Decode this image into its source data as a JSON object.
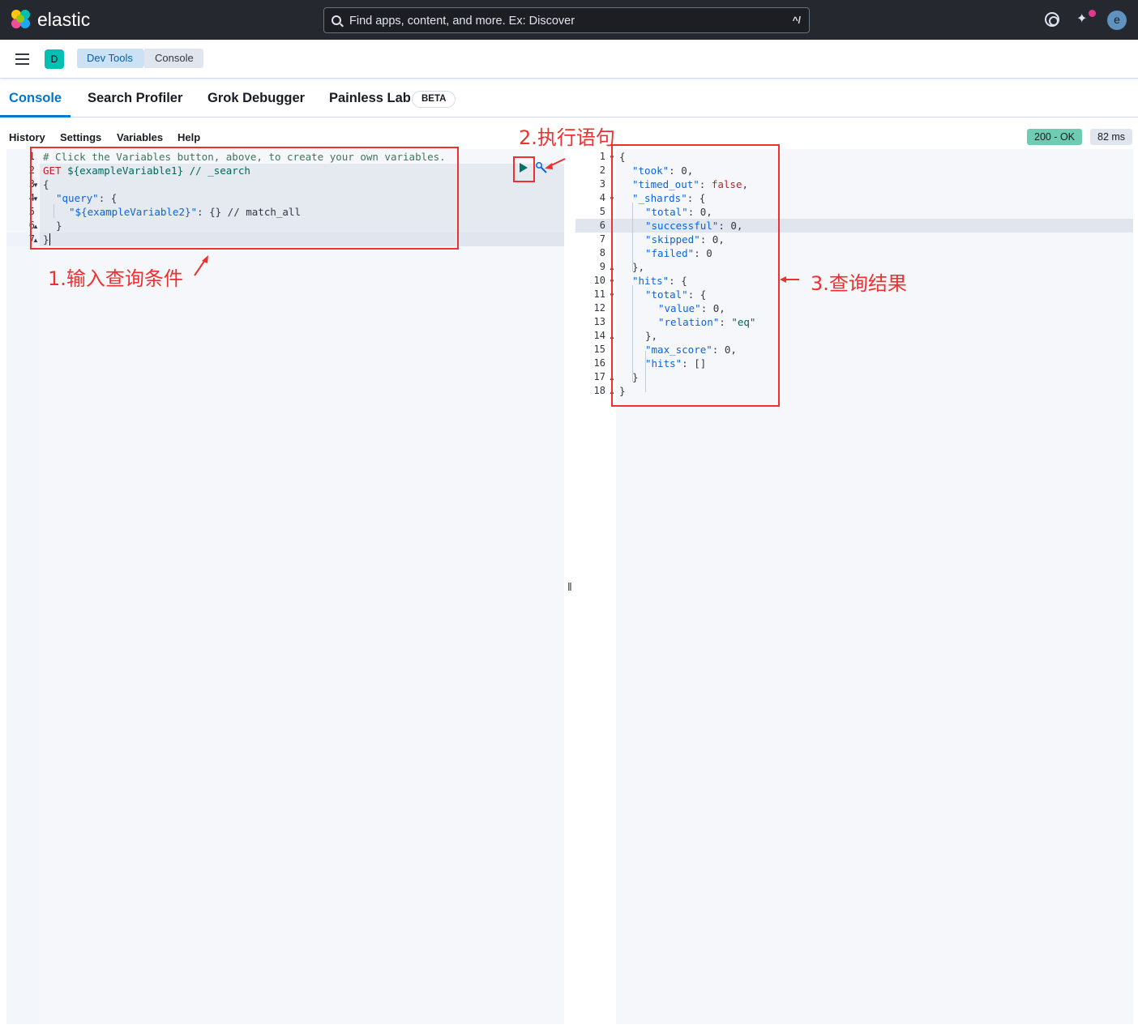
{
  "topbar": {
    "brand": "elastic",
    "search_placeholder": "Find apps, content, and more. Ex: Discover",
    "search_shortcut": "^/",
    "avatar_initial": "e"
  },
  "subbar": {
    "space_initial": "D",
    "breadcrumbs": [
      "Dev Tools",
      "Console"
    ]
  },
  "tabs": [
    {
      "label": "Console",
      "active": true
    },
    {
      "label": "Search Profiler"
    },
    {
      "label": "Grok Debugger"
    },
    {
      "label": "Painless Lab"
    }
  ],
  "beta_badge": "BETA",
  "toolbar": {
    "items": [
      "History",
      "Settings",
      "Variables",
      "Help"
    ],
    "status": "200 - OK",
    "duration": "82 ms"
  },
  "request": {
    "line_numbers": [
      "1",
      "2",
      "3",
      "4",
      "5",
      "6",
      "7"
    ],
    "line1": "# Click the Variables button, above, to create your own variables.",
    "method": "GET",
    "url": "${exampleVariable1} // _search",
    "line3": "{",
    "line4_key": "\"query\"",
    "line4_rest": ": {",
    "line5_key": "\"${exampleVariable2}\"",
    "line5_rest": ": {} // match_all",
    "line6": "}",
    "line7": "}"
  },
  "response": {
    "line_numbers": [
      "1",
      "2",
      "3",
      "4",
      "5",
      "6",
      "7",
      "8",
      "9",
      "10",
      "11",
      "12",
      "13",
      "14",
      "15",
      "16",
      "17",
      "18"
    ],
    "lines": [
      {
        "pre": "{"
      },
      {
        "key": "\"took\"",
        "sep": ": ",
        "val": "0",
        "post": ","
      },
      {
        "key": "\"timed_out\"",
        "sep": ": ",
        "bool": "false",
        "post": ","
      },
      {
        "key": "\"_shards\"",
        "sep": ": {"
      },
      {
        "key": "\"total\"",
        "sep": ": ",
        "val": "0",
        "post": ","
      },
      {
        "key": "\"successful\"",
        "sep": ": ",
        "val": "0",
        "post": ","
      },
      {
        "key": "\"skipped\"",
        "sep": ": ",
        "val": "0",
        "post": ","
      },
      {
        "key": "\"failed\"",
        "sep": ": ",
        "val": "0"
      },
      {
        "pre": "},"
      },
      {
        "key": "\"hits\"",
        "sep": ": {"
      },
      {
        "key": "\"total\"",
        "sep": ": {"
      },
      {
        "key": "\"value\"",
        "sep": ": ",
        "val": "0",
        "post": ","
      },
      {
        "key": "\"relation\"",
        "sep": ": ",
        "str": "\"eq\""
      },
      {
        "pre": "},"
      },
      {
        "key": "\"max_score\"",
        "sep": ": ",
        "val": "0",
        "post": ","
      },
      {
        "key": "\"hits\"",
        "sep": ": []"
      },
      {
        "pre": "}"
      },
      {
        "pre": "}"
      }
    ]
  },
  "annotations": {
    "step1": "1.输入查询条件",
    "step2": "2.执行语句",
    "step3": "3.查询结果"
  },
  "colors": {
    "accent": "#0077cc",
    "annotation": "#ee3030",
    "status_ok": "#6dccb1"
  }
}
